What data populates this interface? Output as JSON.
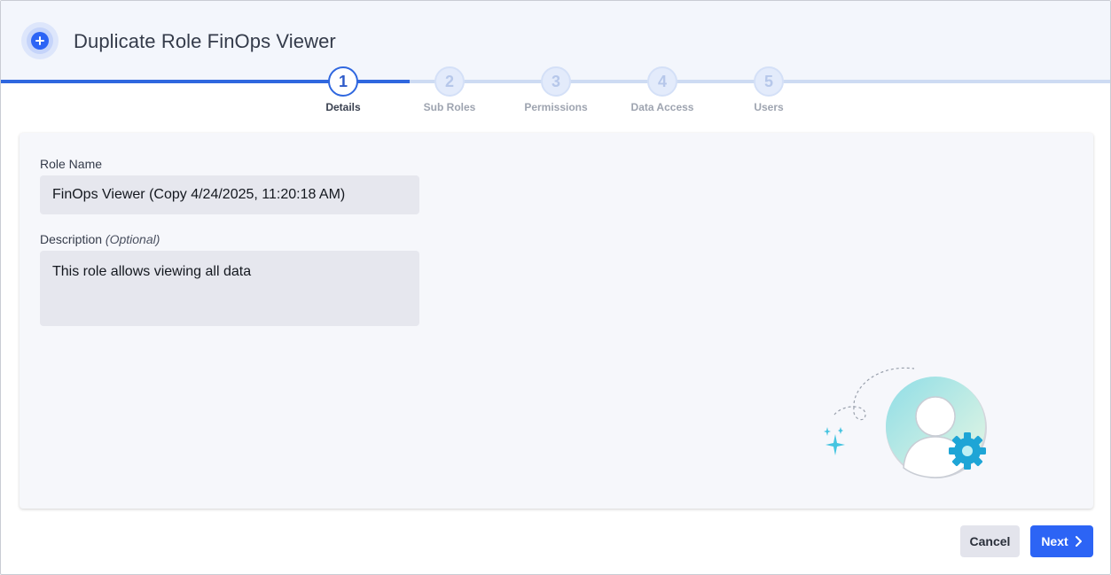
{
  "header": {
    "title": "Duplicate Role FinOps Viewer",
    "icon": "plus-circle-icon"
  },
  "stepper": {
    "progress": 0.2,
    "steps": [
      {
        "number": "1",
        "label": "Details",
        "state": "active"
      },
      {
        "number": "2",
        "label": "Sub Roles",
        "state": "pending"
      },
      {
        "number": "3",
        "label": "Permissions",
        "state": "pending"
      },
      {
        "number": "4",
        "label": "Data Access",
        "state": "pending"
      },
      {
        "number": "5",
        "label": "Users",
        "state": "pending"
      }
    ]
  },
  "form": {
    "role_name_label": "Role Name",
    "role_name_value": "FinOps Viewer (Copy 4/24/2025, 11:20:18 AM)",
    "description_label": "Description",
    "description_optional": "(Optional)",
    "description_value": "This role allows viewing all data"
  },
  "illustration": {
    "icon": "user-settings-icon"
  },
  "footer": {
    "cancel_label": "Cancel",
    "next_label": "Next"
  },
  "colors": {
    "accent": "#2c64f5",
    "header_bg": "#f3f6fc",
    "panel_bg": "#f6f7fb",
    "input_bg": "#e6e7ee"
  }
}
